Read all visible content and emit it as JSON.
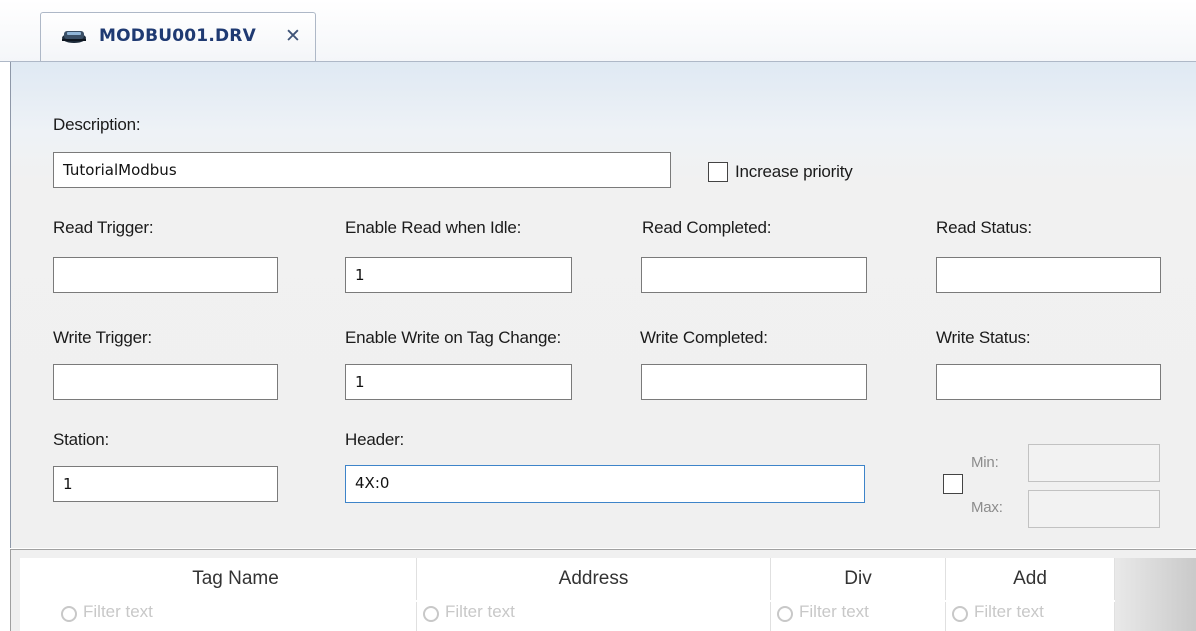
{
  "tab": {
    "title": "MODBU001.DRV",
    "close_glyph": "✕",
    "icon": "driver-icon"
  },
  "form": {
    "description_label": "Description:",
    "description_value": "TutorialModbus",
    "increase_priority_label": "Increase priority",
    "increase_priority_checked": false,
    "read_trigger_label": "Read Trigger:",
    "read_trigger_value": "",
    "enable_read_label": "Enable Read when Idle:",
    "enable_read_value": "1",
    "read_completed_label": "Read Completed:",
    "read_completed_value": "",
    "read_status_label": "Read Status:",
    "read_status_value": "",
    "write_trigger_label": "Write Trigger:",
    "write_trigger_value": "",
    "enable_write_label": "Enable Write on Tag Change:",
    "enable_write_value": "1",
    "write_completed_label": "Write Completed:",
    "write_completed_value": "",
    "write_status_label": "Write Status:",
    "write_status_value": "",
    "station_label": "Station:",
    "station_value": "1",
    "header_label": "Header:",
    "header_value": "4X:0",
    "minmax_checked": false,
    "min_label": "Min:",
    "min_value": "",
    "max_label": "Max:",
    "max_value": ""
  },
  "grid": {
    "columns": [
      {
        "label": "Tag Name",
        "filter_placeholder": "Filter text"
      },
      {
        "label": "Address",
        "filter_placeholder": "Filter text"
      },
      {
        "label": "Div",
        "filter_placeholder": "Filter text"
      },
      {
        "label": "Add",
        "filter_placeholder": "Filter text"
      }
    ]
  },
  "colors": {
    "tab_title": "#1f3a72",
    "focus_border": "#3e84c9"
  }
}
